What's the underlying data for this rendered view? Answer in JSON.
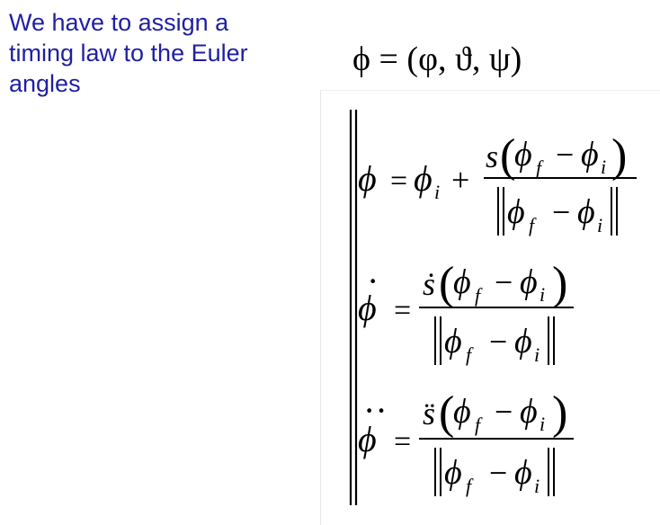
{
  "slide": {
    "text_lines": [
      "We have to assign a",
      "timing law to the Euler",
      "angles"
    ],
    "text_color": "#1f1fa3"
  },
  "euler_tuple": "ϕ = (φ, ϑ, ψ)",
  "equations": {
    "phi": "ϕ",
    "phi_i": "ϕ",
    "phi_f": "ϕ",
    "sub_i": "i",
    "sub_f": "f",
    "eq": "=",
    "plus": "+",
    "minus": "−",
    "s": "s",
    "s_dot": "ṡ",
    "s_ddot": "s̈",
    "lparen": "(",
    "rparen": ")",
    "dot": "·",
    "ddot": "··"
  }
}
